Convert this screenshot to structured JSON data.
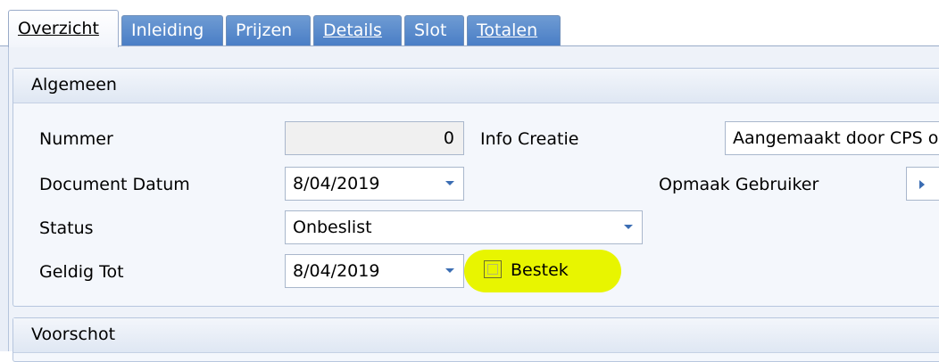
{
  "tabs": [
    {
      "label": "Overzicht",
      "active": true
    },
    {
      "label": "Inleiding"
    },
    {
      "label": "Prijzen"
    },
    {
      "label": "Details"
    },
    {
      "label": "Slot"
    },
    {
      "label": "Totalen"
    }
  ],
  "groups": {
    "algemeen": {
      "title": "Algemeen",
      "fields": {
        "nummer": {
          "label": "Nummer",
          "value": "0"
        },
        "document_datum": {
          "label": "Document Datum",
          "value": "8/04/2019"
        },
        "status": {
          "label": "Status",
          "value": "Onbeslist"
        },
        "geldig_tot": {
          "label": "Geldig Tot",
          "value": "8/04/2019"
        },
        "info_creatie": {
          "label": "Info Creatie",
          "value": "Aangemaakt door CPS o"
        },
        "opmaak_gebruiker": {
          "label": "Opmaak Gebruiker"
        },
        "bestek": {
          "label": "Bestek",
          "checked": false
        }
      }
    },
    "voorschot": {
      "title": "Voorschot"
    }
  },
  "colors": {
    "highlight": "#e8f500",
    "tab_inactive": "#4a7ec6",
    "group_header": "#dfe7f3"
  }
}
